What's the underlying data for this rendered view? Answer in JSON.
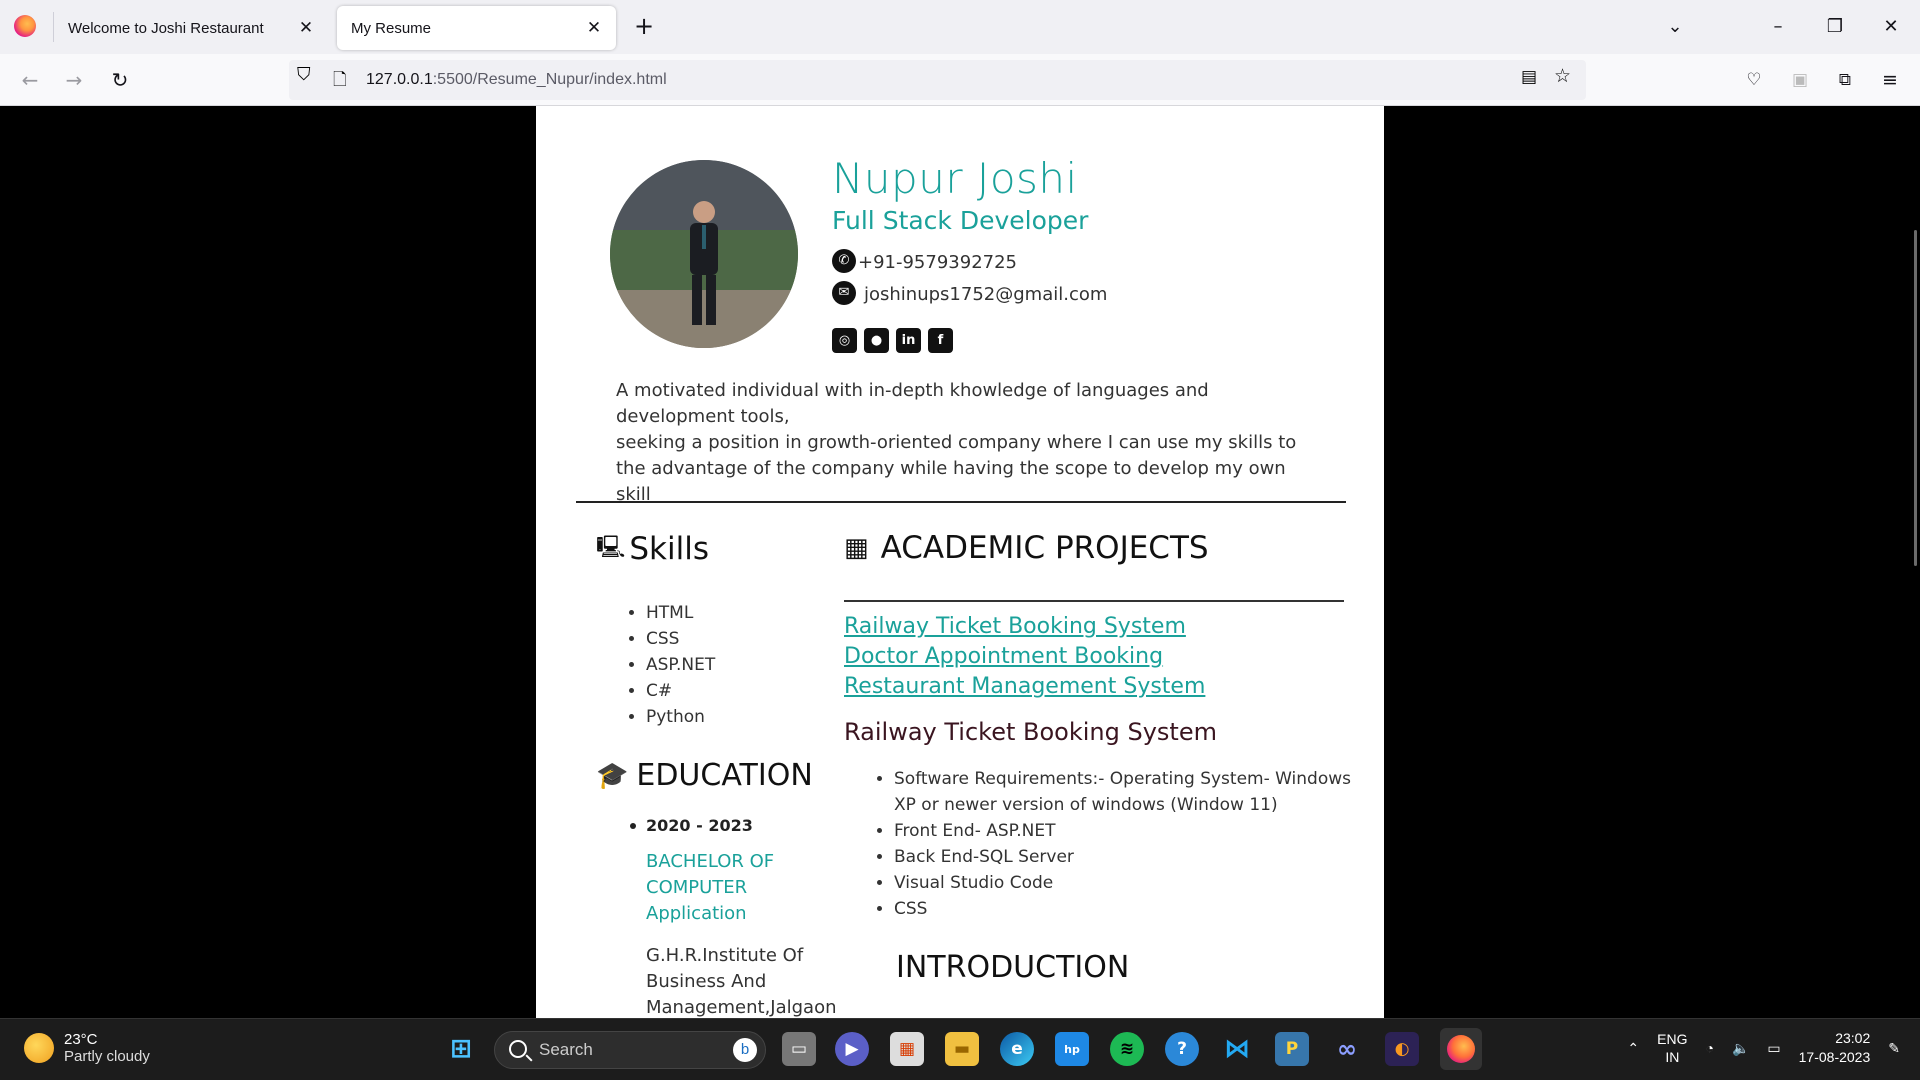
{
  "browser": {
    "tabs": [
      {
        "label": "Welcome to Joshi Restaurant",
        "active": false
      },
      {
        "label": "My Resume",
        "active": true
      }
    ],
    "url_host": "127.0.0.1",
    "url_path": ":5500/Resume_Nupur/index.html"
  },
  "resume": {
    "name": "Nupur Joshi",
    "role": "Full Stack Developer",
    "phone": "+91-9579392725",
    "email": "joshinups1752@gmail.com",
    "social": [
      "instagram-icon",
      "github-icon",
      "linkedin-icon",
      "facebook-icon"
    ],
    "summary_lines": [
      "A motivated individual with in-depth khowledge of languages and development tools,",
      "seeking a position in growth-oriented company where I can use my skills to the advantage of the company while having the scope to develop my own skill"
    ],
    "skills_title": "Skills",
    "skills": [
      "HTML",
      "CSS",
      "ASP.NET",
      "C#",
      "Python"
    ],
    "education_title": "EDUCATION",
    "education": {
      "years": "2020 - 2023",
      "degree": "BACHELOR OF COMPUTER Application",
      "school": "G.H.R.Institute Of Business And Management,Jalgaon |"
    },
    "projects_title": "ACADEMIC PROJECTS",
    "project_links": [
      "Railway Ticket Booking System",
      "Doctor Appointment Booking",
      "Restaurant Management System"
    ],
    "project_heading": "Railway Ticket Booking System",
    "project_requirements": [
      "Software Requirements:- Operating System- Windows XP or newer version of windows (Window 11)",
      "Front End- ASP.NET",
      "Back End-SQL Server",
      "Visual Studio Code",
      "CSS"
    ],
    "intro_title": "INTRODUCTION"
  },
  "taskbar": {
    "weather_temp": "23°C",
    "weather_desc": "Partly cloudy",
    "search_placeholder": "Search",
    "lang_line1": "ENG",
    "lang_line2": "IN",
    "time": "23:02",
    "date": "17-08-2023"
  },
  "colors": {
    "accent": "#1aa19a",
    "page_bg": "#000000"
  }
}
